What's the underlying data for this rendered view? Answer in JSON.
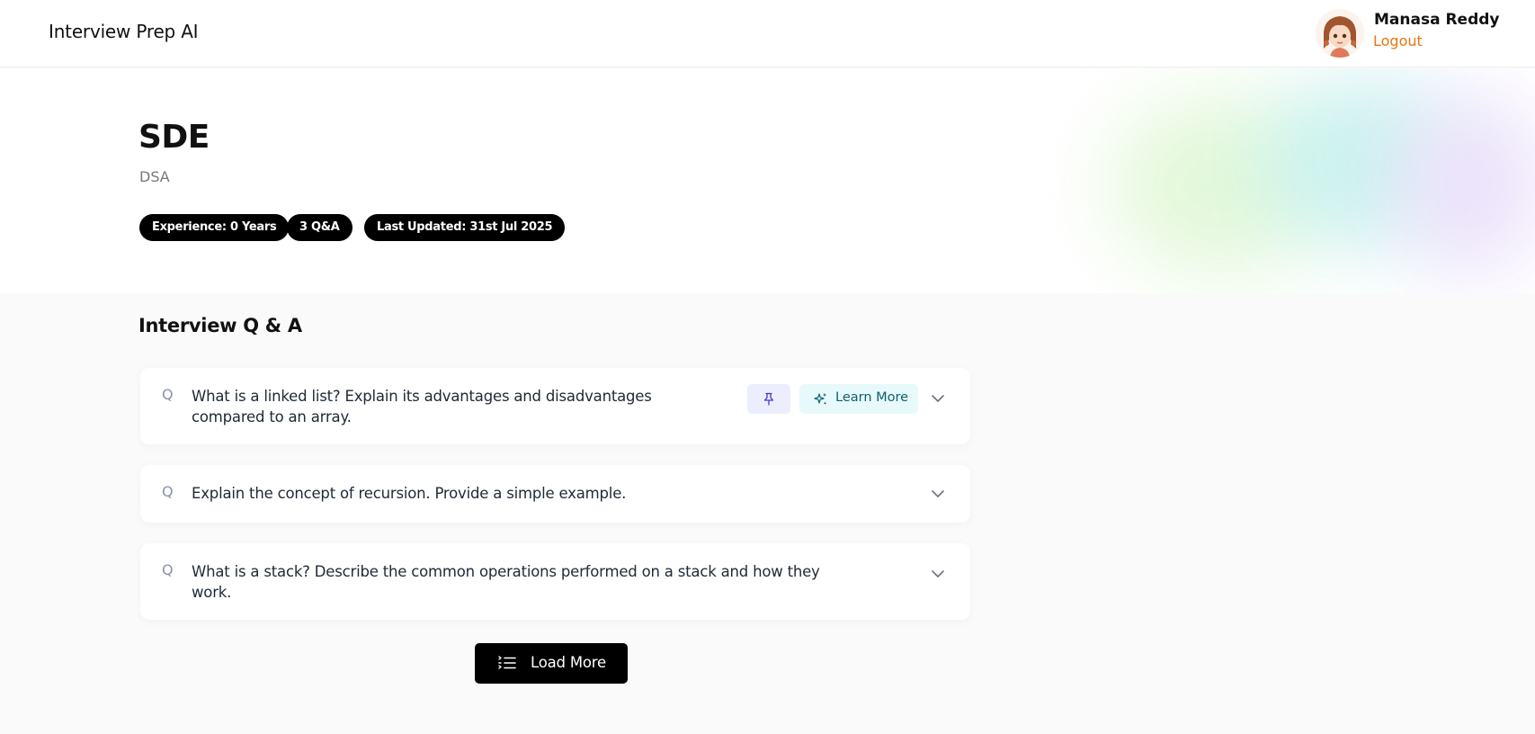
{
  "header": {
    "app_title": "Interview Prep AI",
    "user_name": "Manasa Reddy",
    "logout_label": "Logout",
    "avatar_icon": "avatar-illustration"
  },
  "session": {
    "role": "SDE",
    "topic": "DSA",
    "pills": {
      "experience": "Experience: 0 Years",
      "qa_count": "3 Q&A",
      "last_updated": "Last Updated: 31st Jul 2025"
    }
  },
  "qa_section": {
    "title": "Interview Q & A",
    "question_marker": "Q",
    "learn_more_label": "Learn More",
    "questions": [
      {
        "text": "What is a linked list? Explain its advantages and disadvantages compared to an array."
      },
      {
        "text": "Explain the concept of recursion. Provide a simple example."
      },
      {
        "text": "What is a stack? Describe the common operations performed on a stack and how they work."
      }
    ],
    "load_more_label": "Load More"
  },
  "colors": {
    "accent_logout": "#ea7410",
    "pill_bg": "#000000",
    "learn_bg": "#e8f9fb",
    "pin_bg": "#eceefe"
  }
}
